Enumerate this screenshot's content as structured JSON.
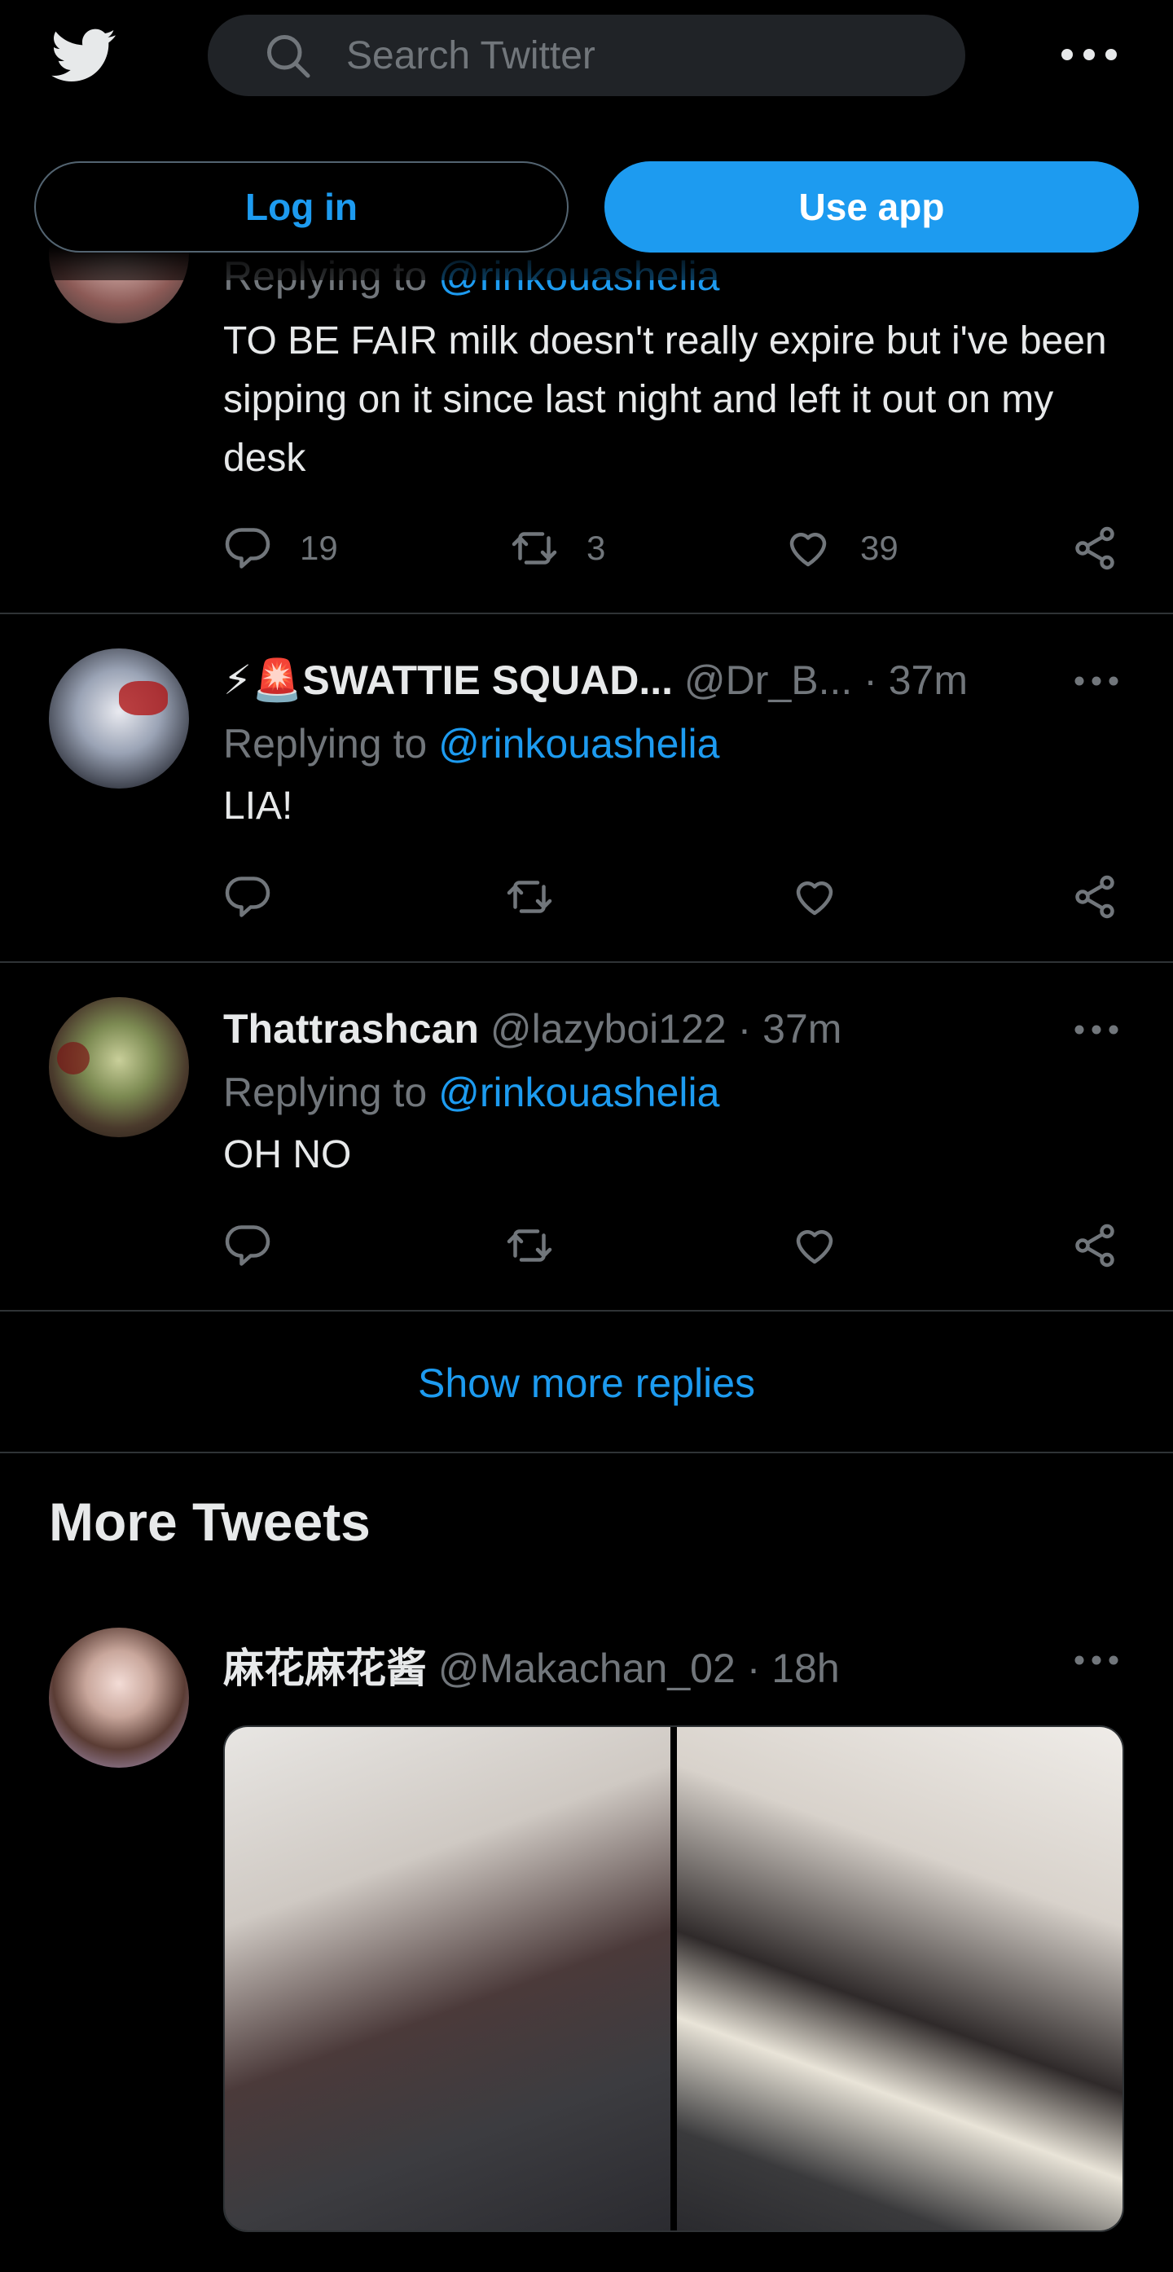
{
  "search": {
    "placeholder": "Search Twitter"
  },
  "auth": {
    "login_label": "Log in",
    "app_label": "Use app"
  },
  "tweets": [
    {
      "reply_to_label": "Replying to",
      "reply_to_handle": "@rinkouashelia",
      "text": "TO BE FAIR milk doesn't really expire but i've been sipping on it since last night and left it out on my desk",
      "replies": "19",
      "retweets": "3",
      "likes": "39"
    },
    {
      "name": "⚡🚨SWATTIE SQUAD...",
      "handle": "@Dr_B...",
      "time": "· 37m",
      "reply_to_label": "Replying to",
      "reply_to_handle": "@rinkouashelia",
      "text": "LIA!"
    },
    {
      "name": "Thattrashcan",
      "handle": "@lazyboi122",
      "time": "· 37m",
      "reply_to_label": "Replying to",
      "reply_to_handle": "@rinkouashelia",
      "text": "OH NO"
    }
  ],
  "show_more_label": "Show more replies",
  "more_tweets": {
    "title": "More Tweets",
    "tweet": {
      "name": "麻花麻花酱",
      "handle": "@Makachan_02",
      "time": "· 18h"
    }
  },
  "icons": {
    "logo": "twitter-bird-icon",
    "search": "search-icon",
    "more": "more-horizontal-icon",
    "reply": "reply-icon",
    "retweet": "retweet-icon",
    "like": "heart-icon",
    "share": "share-icon"
  },
  "colors": {
    "accent": "#1d9bf0",
    "muted": "#71767b",
    "divider": "#2f3336",
    "background": "#000000"
  }
}
